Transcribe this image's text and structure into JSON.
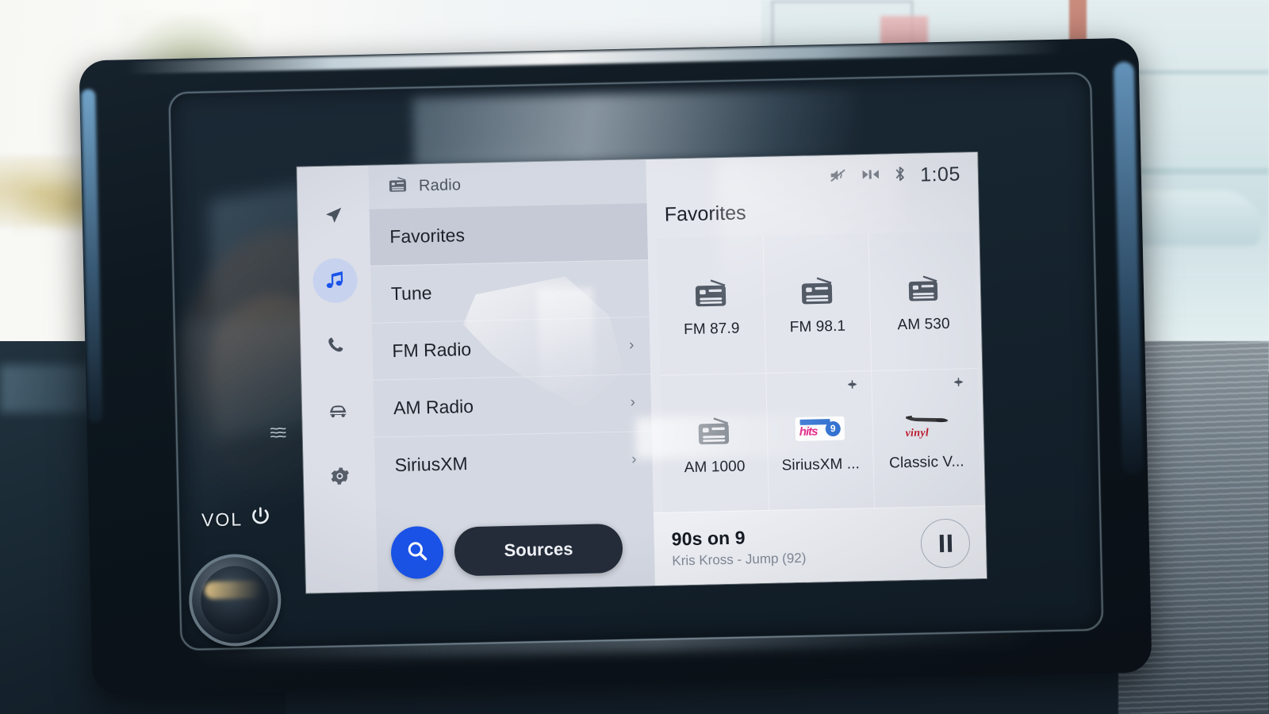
{
  "device": {
    "vol_label": "VOL",
    "power_icon": "power-icon",
    "defrost_icon": "rear-defrost-icon",
    "volume_knob": "volume-knob"
  },
  "nav_rail": {
    "items": [
      {
        "icon": "navigation-arrow-icon",
        "name": "navigation",
        "active": false
      },
      {
        "icon": "music-note-icon",
        "name": "media",
        "active": true
      },
      {
        "icon": "phone-icon",
        "name": "phone",
        "active": false
      },
      {
        "icon": "car-icon",
        "name": "vehicle",
        "active": false
      },
      {
        "icon": "gear-icon",
        "name": "settings",
        "active": false
      }
    ]
  },
  "source_panel": {
    "header_icon": "radio-icon",
    "header_label": "Radio",
    "items": [
      {
        "label": "Favorites",
        "selected": true,
        "has_chevron": false
      },
      {
        "label": "Tune",
        "selected": false,
        "has_chevron": false
      },
      {
        "label": "FM Radio",
        "selected": false,
        "has_chevron": true
      },
      {
        "label": "AM Radio",
        "selected": false,
        "has_chevron": true
      },
      {
        "label": "SiriusXM",
        "selected": false,
        "has_chevron": true
      }
    ],
    "search_icon": "search-icon",
    "sources_label": "Sources"
  },
  "status_bar": {
    "icons": [
      "volume-mute-icon",
      "media-skip-icon",
      "bluetooth-icon"
    ],
    "clock": "1:05"
  },
  "content": {
    "title": "Favorites",
    "favorites": [
      {
        "label": "FM 87.9",
        "icon": "radio-icon",
        "satellite_badge": false
      },
      {
        "label": "FM 98.1",
        "icon": "radio-icon",
        "satellite_badge": false
      },
      {
        "label": "AM 530",
        "icon": "radio-icon",
        "satellite_badge": false
      },
      {
        "label": "AM 1000",
        "icon": "radio-icon",
        "satellite_badge": false
      },
      {
        "label": "SiriusXM ...",
        "icon": "logo-90s-on-9",
        "satellite_badge": true
      },
      {
        "label": "Classic V...",
        "icon": "logo-classic-vinyl",
        "satellite_badge": true
      }
    ]
  },
  "now_playing": {
    "title": "90s on 9",
    "subtitle": "Kris Kross - Jump (92)",
    "transport_icon": "pause-icon"
  },
  "colors": {
    "accent_blue": "#1a53ea",
    "rail_active": "#c6d2ee",
    "music_note": "#1a53ea",
    "sources_dark": "#242c3a",
    "screen_bg": "#e7e9ef",
    "list_bg": "#d4d8e2",
    "selected_row": "#c5cad6",
    "vinyl_red": "#c0172a",
    "hits_pink": "#e0197f",
    "hits_blue": "#2f6fd0"
  }
}
